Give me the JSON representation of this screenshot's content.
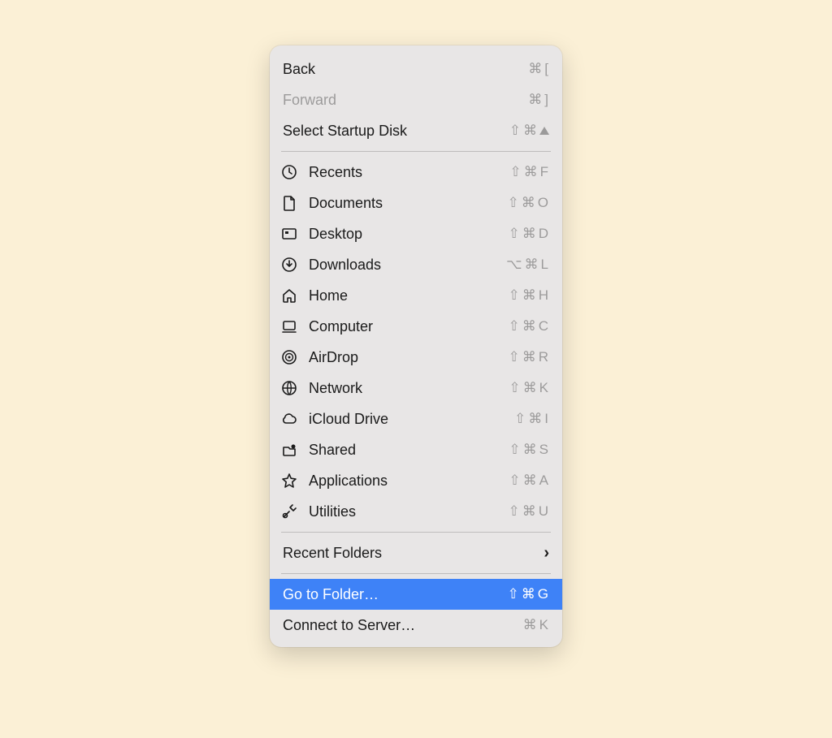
{
  "menu": {
    "groups": [
      [
        {
          "id": "back",
          "label": "Back",
          "icon": null,
          "shortcut": "⌘ [",
          "disabled": false
        },
        {
          "id": "forward",
          "label": "Forward",
          "icon": null,
          "shortcut": "⌘ ]",
          "disabled": true
        },
        {
          "id": "select-startup-disk",
          "label": "Select Startup Disk",
          "icon": null,
          "shortcut": "⇧ ⌘ ▲",
          "disabled": false
        }
      ],
      [
        {
          "id": "recents",
          "label": "Recents",
          "icon": "clock",
          "shortcut": "⇧ ⌘ F"
        },
        {
          "id": "documents",
          "label": "Documents",
          "icon": "document",
          "shortcut": "⇧ ⌘ O"
        },
        {
          "id": "desktop",
          "label": "Desktop",
          "icon": "desktop",
          "shortcut": "⇧ ⌘ D"
        },
        {
          "id": "downloads",
          "label": "Downloads",
          "icon": "download",
          "shortcut": "⌥ ⌘ L"
        },
        {
          "id": "home",
          "label": "Home",
          "icon": "home",
          "shortcut": "⇧ ⌘ H"
        },
        {
          "id": "computer",
          "label": "Computer",
          "icon": "computer",
          "shortcut": "⇧ ⌘ C"
        },
        {
          "id": "airdrop",
          "label": "AirDrop",
          "icon": "airdrop",
          "shortcut": "⇧ ⌘ R"
        },
        {
          "id": "network",
          "label": "Network",
          "icon": "network",
          "shortcut": "⇧ ⌘ K"
        },
        {
          "id": "icloud-drive",
          "label": "iCloud Drive",
          "icon": "cloud",
          "shortcut": "⇧ ⌘ I"
        },
        {
          "id": "shared",
          "label": "Shared",
          "icon": "shared",
          "shortcut": "⇧ ⌘ S"
        },
        {
          "id": "applications",
          "label": "Applications",
          "icon": "applications",
          "shortcut": "⇧ ⌘ A"
        },
        {
          "id": "utilities",
          "label": "Utilities",
          "icon": "utilities",
          "shortcut": "⇧ ⌘ U"
        }
      ],
      [
        {
          "id": "recent-folders",
          "label": "Recent Folders",
          "icon": null,
          "shortcut": null,
          "submenu": true
        }
      ],
      [
        {
          "id": "go-to-folder",
          "label": "Go to Folder…",
          "icon": null,
          "shortcut": "⇧ ⌘ G",
          "selected": true
        },
        {
          "id": "connect-to-server",
          "label": "Connect to Server…",
          "icon": null,
          "shortcut": "⌘ K"
        }
      ]
    ]
  }
}
